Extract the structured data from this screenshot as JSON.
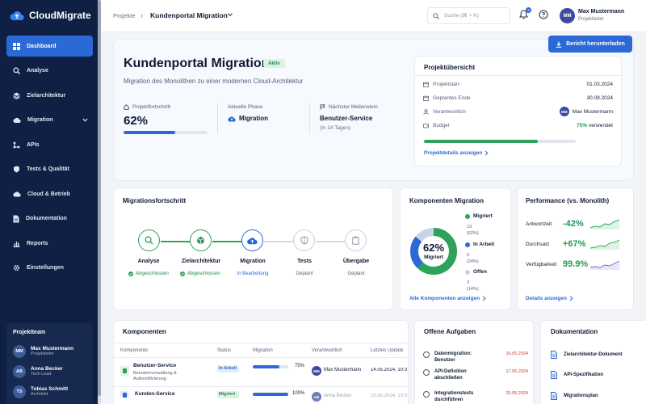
{
  "app": {
    "name": "CloudMigrate"
  },
  "colors": {
    "accent": "#2b69d6",
    "success": "#2ea25a",
    "sidebar": "#0f2044",
    "danger": "#d43535",
    "donut_done": "#2ea25a",
    "donut_progress": "#2b69d6",
    "donut_open": "#c9d3e6"
  },
  "sidebar": {
    "items": [
      {
        "label": "Dashboard",
        "icon": "grid-icon"
      },
      {
        "label": "Analyse",
        "icon": "magnifier-icon"
      },
      {
        "label": "Zielarchitektur",
        "icon": "layers-icon"
      },
      {
        "label": "Migration",
        "icon": "cloud-upload-icon"
      },
      {
        "label": "APIs",
        "icon": "api-icon"
      },
      {
        "label": "Tests & Qualität",
        "icon": "shield-icon"
      },
      {
        "label": "Cloud & Betrieb",
        "icon": "cloud-icon"
      },
      {
        "label": "Dokumentation",
        "icon": "document-icon"
      },
      {
        "label": "Reports",
        "icon": "bar-chart-icon"
      },
      {
        "label": "Einstellungen",
        "icon": "gear-icon"
      }
    ],
    "team_title": "Projektteam",
    "team": [
      {
        "initials": "MM",
        "name": "Max Mustermann",
        "role": "Projektleiter"
      },
      {
        "initials": "AB",
        "name": "Anna Becker",
        "role": "Tech Lead"
      },
      {
        "initials": "TS",
        "name": "Tobias Schmitt",
        "role": "Architekt"
      }
    ]
  },
  "topbar": {
    "breadcrumb_root": "Projekte",
    "breadcrumb_sep": "›",
    "breadcrumb_current": "Kundenportal Migration",
    "search_placeholder": "Suche (⌘ + K)",
    "notifications": "3",
    "user_initials": "MM",
    "user_name": "Max Mustermann",
    "user_role": "Projektleiter"
  },
  "hero": {
    "report_button": "Bericht herunterladen",
    "title": "Kundenportal Migration",
    "status": "Aktiv",
    "subtitle": "Migration des Monolithen zu einer modernen Cloud-Architektur",
    "progress_label": "Projektfortschritt",
    "progress_value": "62%",
    "progress_fraction": 0.62,
    "phase_label": "Aktuelle Phase",
    "phase_value": "Migration",
    "milestone_label": "Nächster Meilenstein",
    "milestone_value": "Benutzer-Service",
    "milestone_sub": "(In 14 Tagen)"
  },
  "overview": {
    "title": "Projektübersicht",
    "rows": [
      {
        "label": "Projektstart",
        "value": "01.03.2024",
        "icon": "calendar-icon"
      },
      {
        "label": "Geplantes Ende",
        "value": "30.09.2024",
        "icon": "calendar-icon"
      },
      {
        "label": "Verantwortlich",
        "value": "Max Mustermann",
        "icon": "person-icon"
      },
      {
        "label": "Budget",
        "value_pct": "75%",
        "value_suffix": "verwendet",
        "icon": "wallet-icon"
      }
    ],
    "budget_fraction": 0.75,
    "link": "Projektdetails anzeigen"
  },
  "steps": {
    "title": "Migrationsfortschritt",
    "items": [
      {
        "name": "Analyse",
        "state": "Abgeschlossen",
        "kind": "done"
      },
      {
        "name": "Zielarchitektur",
        "state": "Abgeschlossen",
        "kind": "done"
      },
      {
        "name": "Migration",
        "state": "In Bearbeitung",
        "kind": "active"
      },
      {
        "name": "Tests",
        "state": "Geplant",
        "kind": "planned"
      },
      {
        "name": "Übergabe",
        "state": "Geplant",
        "kind": "planned"
      }
    ]
  },
  "donut": {
    "title": "Komponenten Migration",
    "center_value": "62%",
    "center_label": "Migriert",
    "legend": [
      {
        "label": "Migriert",
        "count": "13",
        "pct": "(62%)"
      },
      {
        "label": "In Arbeit",
        "count": "5",
        "pct": "(24%)"
      },
      {
        "label": "Offen",
        "count": "3",
        "pct": "(14%)"
      }
    ],
    "link": "Alle Komponenten anzeigen"
  },
  "performance": {
    "title": "Performance (vs. Monolith)",
    "rows": [
      {
        "label": "Antwortzeit",
        "value": "-42%"
      },
      {
        "label": "Durchsatz",
        "value": "+67%"
      },
      {
        "label": "Verfügbarkeit",
        "value": "99.9%"
      }
    ],
    "link": "Details anzeigen"
  },
  "components": {
    "title": "Komponenten",
    "headers": [
      "Komponente",
      "Status",
      "Migration",
      "Verantwortlich",
      "Letztes Update"
    ],
    "rows": [
      {
        "name": "Benutzer-Service",
        "desc": "Benutzerverwaltung & Authentifizierung",
        "status": "In Arbeit",
        "migration": "75%",
        "migration_fraction": 0.75,
        "owner_initials": "MM",
        "owner": "Max Mustermann",
        "updated": "14.05.2024, 10:3"
      },
      {
        "name": "Kunden-Service",
        "desc": "",
        "status": "Migriert",
        "migration": "100%",
        "migration_fraction": 1.0,
        "owner_initials": "AB",
        "owner": "Anna Becker",
        "updated": "15.05.2024, 10:3"
      }
    ]
  },
  "tasks": {
    "title": "Offene Aufgaben",
    "items": [
      {
        "text": "Datenmigration: Benutzer",
        "date": "16.05.2024"
      },
      {
        "text": "API-Definition abschließen",
        "date": "17.05.2024"
      },
      {
        "text": "Integrationstests durchführen",
        "date": "20.05.2024"
      }
    ]
  },
  "docs": {
    "title": "Dokumentation",
    "items": [
      {
        "name": "Zielarchitektur-Dokument"
      },
      {
        "name": "API-Spezifikation"
      },
      {
        "name": "Migrationsplan"
      }
    ]
  }
}
